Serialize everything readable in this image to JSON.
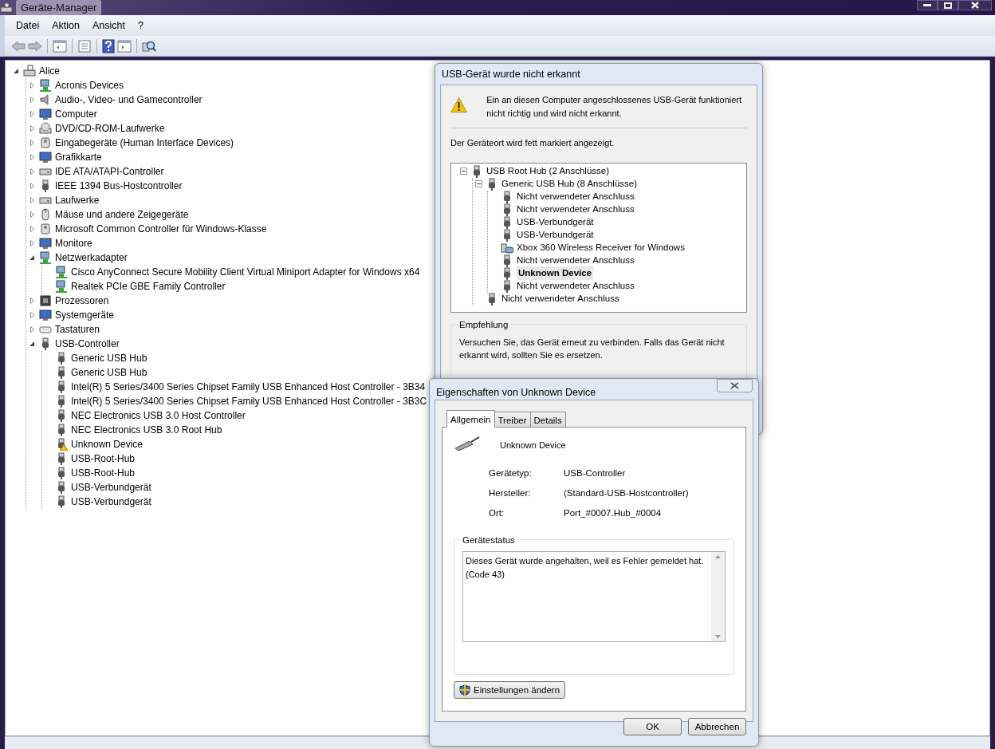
{
  "window": {
    "title": "Geräte-Manager"
  },
  "menu": [
    "Datei",
    "Aktion",
    "Ansicht",
    "?"
  ],
  "tree": {
    "label": "Alice",
    "kind": "computer",
    "expanded": true,
    "children": [
      {
        "label": "Acronis Devices",
        "kind": "network",
        "expanded": false
      },
      {
        "label": "Audio-, Video- und Gamecontroller",
        "kind": "speaker",
        "expanded": false
      },
      {
        "label": "Computer",
        "kind": "monitor",
        "expanded": false
      },
      {
        "label": "DVD/CD-ROM-Laufwerke",
        "kind": "disc",
        "expanded": false
      },
      {
        "label": "Eingabegeräte (Human Interface Devices)",
        "kind": "device",
        "expanded": false
      },
      {
        "label": "Grafikkarte",
        "kind": "monitor",
        "expanded": false
      },
      {
        "label": "IDE ATA/ATAPI-Controller",
        "kind": "drive",
        "expanded": false
      },
      {
        "label": "IEEE 1394 Bus-Hostcontroller",
        "kind": "usb",
        "expanded": false
      },
      {
        "label": "Laufwerke",
        "kind": "drive",
        "expanded": false
      },
      {
        "label": "Mäuse und andere Zeigegeräte",
        "kind": "mouse",
        "expanded": false
      },
      {
        "label": "Microsoft Common Controller für Windows-Klasse",
        "kind": "device",
        "expanded": false
      },
      {
        "label": "Monitore",
        "kind": "monitor",
        "expanded": false
      },
      {
        "label": "Netzwerkadapter",
        "kind": "network",
        "expanded": true,
        "children": [
          {
            "label": "Cisco AnyConnect Secure Mobility Client Virtual Miniport Adapter for Windows x64",
            "kind": "network"
          },
          {
            "label": "Realtek PCIe GBE Family Controller",
            "kind": "network"
          }
        ]
      },
      {
        "label": "Prozessoren",
        "kind": "chip",
        "expanded": false
      },
      {
        "label": "Systemgeräte",
        "kind": "monitor",
        "expanded": false
      },
      {
        "label": "Tastaturen",
        "kind": "keyboard",
        "expanded": false
      },
      {
        "label": "USB-Controller",
        "kind": "usb",
        "expanded": true,
        "children": [
          {
            "label": "Generic USB Hub",
            "kind": "usb"
          },
          {
            "label": "Generic USB Hub",
            "kind": "usb"
          },
          {
            "label": "Intel(R) 5 Series/3400 Series Chipset Family USB Enhanced Host Controller - 3B34",
            "kind": "usb"
          },
          {
            "label": "Intel(R) 5 Series/3400 Series Chipset Family USB Enhanced Host Controller - 3B3C",
            "kind": "usb"
          },
          {
            "label": "NEC Electronics USB 3.0 Host Controller",
            "kind": "usb"
          },
          {
            "label": "NEC Electronics USB 3.0 Root Hub",
            "kind": "usb"
          },
          {
            "label": "Unknown Device",
            "kind": "usb-warning"
          },
          {
            "label": "USB-Root-Hub",
            "kind": "usb"
          },
          {
            "label": "USB-Root-Hub",
            "kind": "usb"
          },
          {
            "label": "USB-Verbundgerät",
            "kind": "usb"
          },
          {
            "label": "USB-Verbundgerät",
            "kind": "usb"
          }
        ]
      }
    ]
  },
  "usb_dialog": {
    "title": "USB-Gerät wurde nicht erkannt",
    "message": "Ein an diesen Computer angeschlossenes USB-Gerät funktioniert nicht richtig und wird nicht erkannt.",
    "hint": "Der Geräteort wird fett markiert angezeigt.",
    "tree": [
      {
        "label": "USB Root Hub (2 Anschlüsse)",
        "kind": "usb",
        "highlighted": false,
        "expanded": true,
        "children": [
          {
            "label": "Generic USB Hub (8 Anschlüsse)",
            "kind": "usb",
            "highlighted": false,
            "expanded": true,
            "children": [
              {
                "label": "Nicht verwendeter Anschluss",
                "kind": "usb",
                "highlighted": false
              },
              {
                "label": "Nicht verwendeter Anschluss",
                "kind": "usb",
                "highlighted": false
              },
              {
                "label": "USB-Verbundgerät",
                "kind": "usb",
                "highlighted": false
              },
              {
                "label": "USB-Verbundgerät",
                "kind": "usb",
                "highlighted": false
              },
              {
                "label": "Xbox 360 Wireless Receiver for Windows",
                "kind": "gamepad",
                "highlighted": false
              },
              {
                "label": "Nicht verwendeter Anschluss",
                "kind": "usb",
                "highlighted": false
              },
              {
                "label": "Unknown Device",
                "kind": "usb",
                "highlighted": true
              },
              {
                "label": "Nicht verwendeter Anschluss",
                "kind": "usb",
                "highlighted": false
              }
            ]
          },
          {
            "label": "Nicht verwendeter Anschluss",
            "kind": "usb",
            "highlighted": false
          }
        ]
      }
    ],
    "recommendation": {
      "title": "Empfehlung",
      "text": "Versuchen Sie, das Gerät erneut zu verbinden. Falls das Gerät nicht erkannt wird, sollten Sie es ersetzen."
    }
  },
  "properties_dialog": {
    "title": "Eigenschaften von Unknown Device",
    "tabs": [
      {
        "label": "Allgemein",
        "selected": true
      },
      {
        "label": "Treiber",
        "selected": false
      },
      {
        "label": "Details",
        "selected": false
      }
    ],
    "device_name": "Unknown Device",
    "fields": [
      {
        "label": "Gerätetyp:",
        "value": "USB-Controller"
      },
      {
        "label": "Hersteller:",
        "value": "(Standard-USB-Hostcontroller)"
      },
      {
        "label": "Ort:",
        "value": "Port_#0007.Hub_#0004"
      }
    ],
    "status": {
      "title": "Gerätestatus",
      "lines": [
        "Dieses Gerät wurde angehalten, weil es Fehler gemeldet hat.",
        "(Code 43)"
      ]
    },
    "settings_button": "Einstellungen ändern",
    "buttons": [
      "OK",
      "Abbrechen"
    ]
  }
}
